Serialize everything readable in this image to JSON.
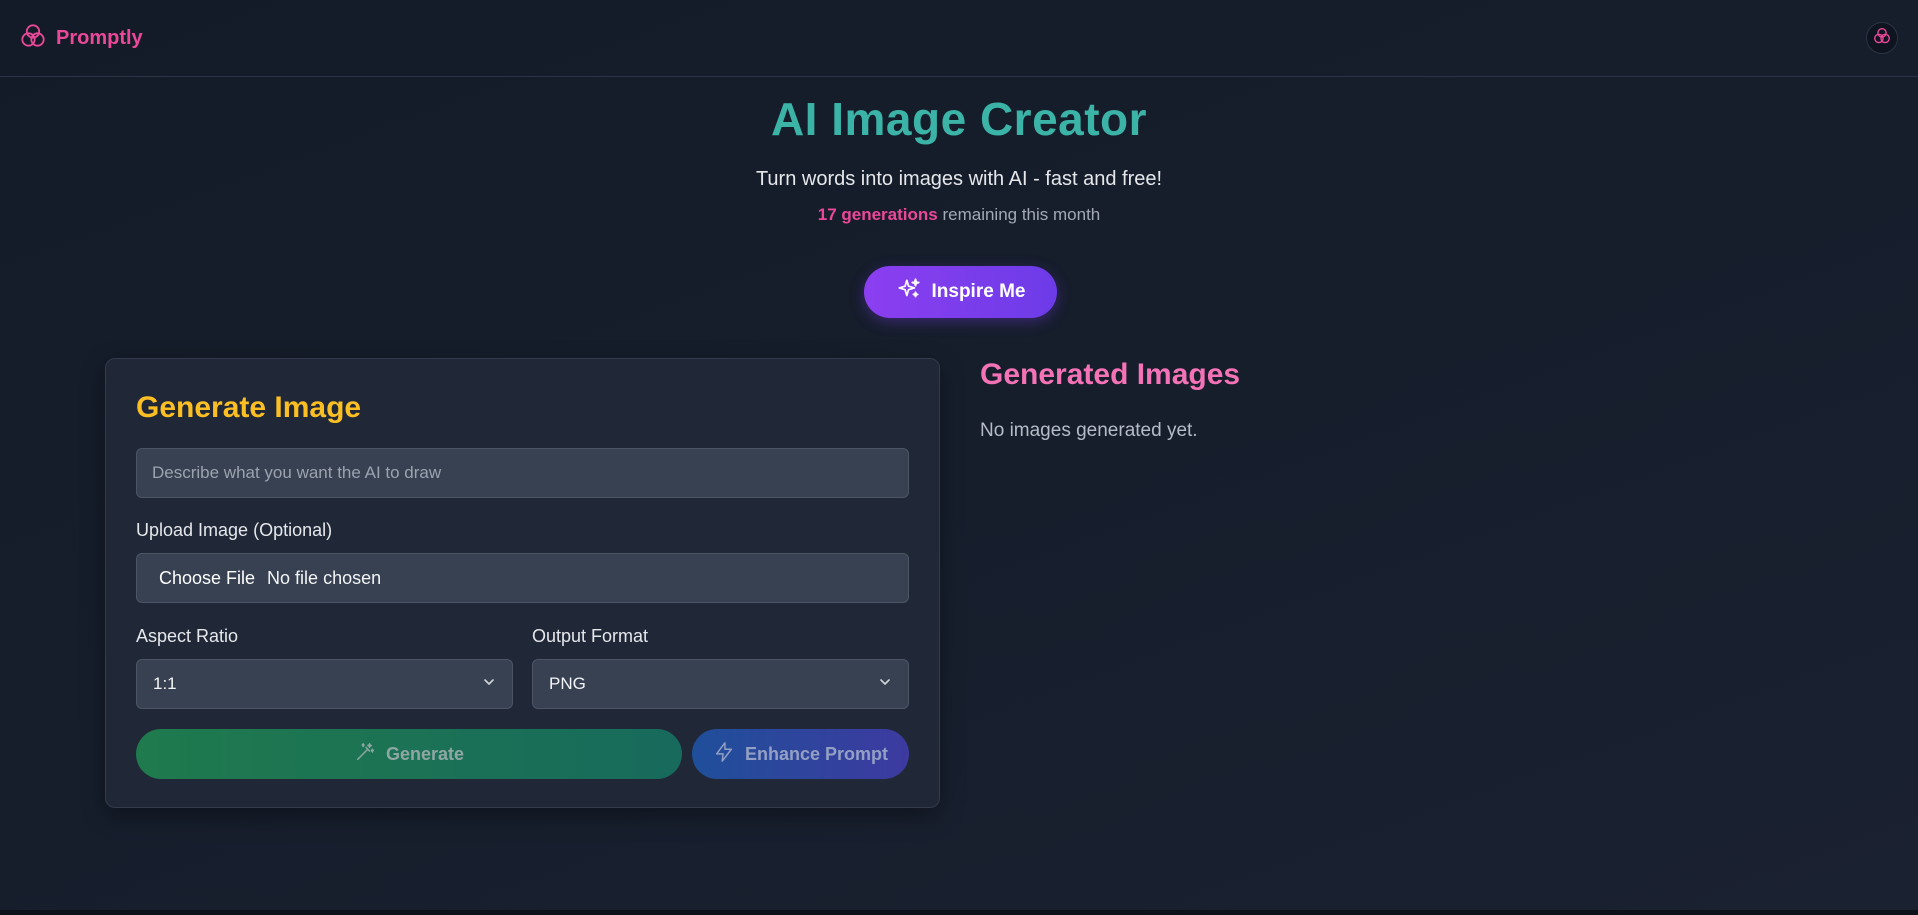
{
  "header": {
    "brand_name": "Promptly",
    "logo_icon": "triple-ring-logo-icon",
    "avatar_icon": "profile-logo-icon"
  },
  "hero": {
    "title": "AI Image Creator",
    "subtitle": "Turn words into images with AI - fast and free!",
    "quota_count": "17 generations",
    "quota_suffix": " remaining this month",
    "inspire_label": "Inspire Me",
    "inspire_icon": "sparkles-icon"
  },
  "form": {
    "title": "Generate Image",
    "prompt_placeholder": "Describe what you want the AI to draw",
    "prompt_value": "",
    "upload_label": "Upload Image (Optional)",
    "choose_file_label": "Choose File",
    "no_file_text": "No file chosen",
    "aspect_label": "Aspect Ratio",
    "aspect_value": "1:1",
    "format_label": "Output Format",
    "format_value": "PNG",
    "generate_label": "Generate",
    "generate_icon": "magic-wand-icon",
    "enhance_label": "Enhance Prompt",
    "enhance_icon": "lightning-icon"
  },
  "results": {
    "title": "Generated Images",
    "empty_text": "No images generated yet."
  },
  "colors": {
    "accent_pink": "#ec4899",
    "title_teal": "#3bb3a7",
    "card_title_yellow": "#fbbf24",
    "inspire_purple": "#8b3ff0",
    "generate_green": "#1f7a4d",
    "enhance_blue": "#1f4f9a"
  }
}
